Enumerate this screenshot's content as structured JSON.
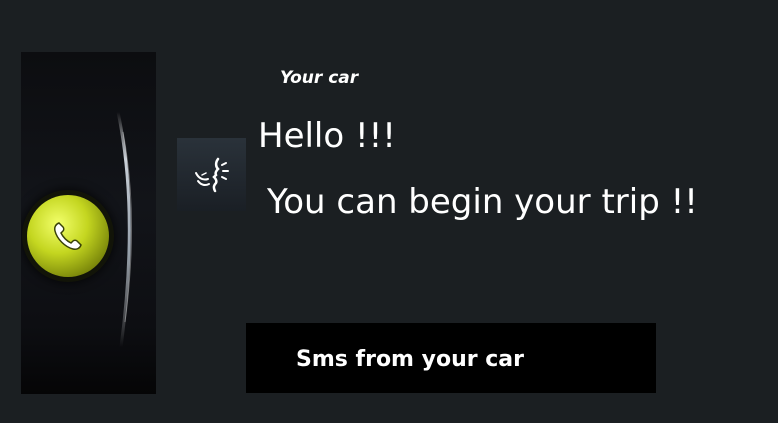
{
  "notification": {
    "sender": "Your car",
    "line1": "Hello !!!",
    "line2": "You can begin your trip !!",
    "footer_label": "Sms from your car"
  },
  "icons": {
    "call": "phone-handset-icon",
    "voice": "voice-speaking-icon"
  },
  "colors": {
    "background": "#1b1f22",
    "call_button": "#c4d620",
    "footer_bar": "#000000",
    "text": "#ffffff"
  }
}
